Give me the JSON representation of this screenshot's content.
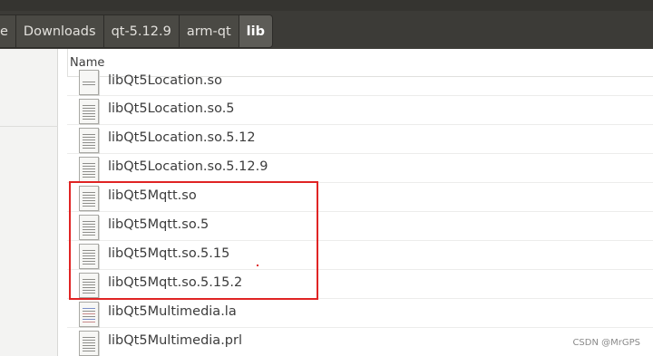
{
  "breadcrumbs": [
    {
      "label": "e"
    },
    {
      "label": "Downloads"
    },
    {
      "label": "qt-5.12.9"
    },
    {
      "label": "arm-qt"
    },
    {
      "label": "lib"
    }
  ],
  "columns": {
    "name": "Name"
  },
  "files": [
    {
      "name": "libQt5Location.so",
      "icon": "text-file-icon"
    },
    {
      "name": "libQt5Location.so.5",
      "icon": "text-file-icon"
    },
    {
      "name": "libQt5Location.so.5.12",
      "icon": "text-file-icon"
    },
    {
      "name": "libQt5Location.so.5.12.9",
      "icon": "text-file-icon"
    },
    {
      "name": "libQt5Mqtt.so",
      "icon": "text-file-icon"
    },
    {
      "name": "libQt5Mqtt.so.5",
      "icon": "text-file-icon"
    },
    {
      "name": "libQt5Mqtt.so.5.15",
      "icon": "text-file-icon"
    },
    {
      "name": "libQt5Mqtt.so.5.15.2",
      "icon": "text-file-icon"
    },
    {
      "name": "libQt5Multimedia.la",
      "icon": "script-file-icon"
    },
    {
      "name": "libQt5Multimedia.prl",
      "icon": "text-file-icon"
    }
  ],
  "watermark": "CSDN @MrGPS",
  "colors": {
    "highlight": "#e02424",
    "header_bg": "#3c3b37"
  }
}
